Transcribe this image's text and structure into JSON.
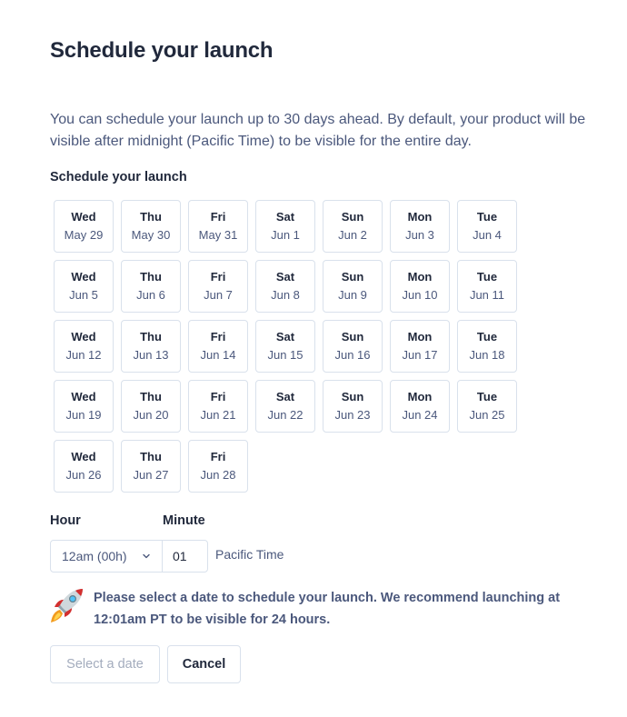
{
  "dialog": {
    "title": "Schedule your launch",
    "intro": "You can schedule your launch up to 30 days ahead. By default, your product will be visible after midnight (Pacific Time) to be visible for the entire day.",
    "section_label": "Schedule your launch"
  },
  "days": [
    {
      "dow": "Wed",
      "date": "May 29"
    },
    {
      "dow": "Thu",
      "date": "May 30"
    },
    {
      "dow": "Fri",
      "date": "May 31"
    },
    {
      "dow": "Sat",
      "date": "Jun 1"
    },
    {
      "dow": "Sun",
      "date": "Jun 2"
    },
    {
      "dow": "Mon",
      "date": "Jun 3"
    },
    {
      "dow": "Tue",
      "date": "Jun 4"
    },
    {
      "dow": "Wed",
      "date": "Jun 5"
    },
    {
      "dow": "Thu",
      "date": "Jun 6"
    },
    {
      "dow": "Fri",
      "date": "Jun 7"
    },
    {
      "dow": "Sat",
      "date": "Jun 8"
    },
    {
      "dow": "Sun",
      "date": "Jun 9"
    },
    {
      "dow": "Mon",
      "date": "Jun 10"
    },
    {
      "dow": "Tue",
      "date": "Jun 11"
    },
    {
      "dow": "Wed",
      "date": "Jun 12"
    },
    {
      "dow": "Thu",
      "date": "Jun 13"
    },
    {
      "dow": "Fri",
      "date": "Jun 14"
    },
    {
      "dow": "Sat",
      "date": "Jun 15"
    },
    {
      "dow": "Sun",
      "date": "Jun 16"
    },
    {
      "dow": "Mon",
      "date": "Jun 17"
    },
    {
      "dow": "Tue",
      "date": "Jun 18"
    },
    {
      "dow": "Wed",
      "date": "Jun 19"
    },
    {
      "dow": "Thu",
      "date": "Jun 20"
    },
    {
      "dow": "Fri",
      "date": "Jun 21"
    },
    {
      "dow": "Sat",
      "date": "Jun 22"
    },
    {
      "dow": "Sun",
      "date": "Jun 23"
    },
    {
      "dow": "Mon",
      "date": "Jun 24"
    },
    {
      "dow": "Tue",
      "date": "Jun 25"
    },
    {
      "dow": "Wed",
      "date": "Jun 26"
    },
    {
      "dow": "Thu",
      "date": "Jun 27"
    },
    {
      "dow": "Fri",
      "date": "Jun 28"
    }
  ],
  "time": {
    "hour_label": "Hour",
    "minute_label": "Minute",
    "hour_value": "12am (00h)",
    "minute_value": "01",
    "timezone": "Pacific Time"
  },
  "notice": {
    "icon": "rocket-icon",
    "text": "Please select a date to schedule your launch. We recommend launching at 12:01am PT to be visible for 24 hours."
  },
  "actions": {
    "select_label": "Select a date",
    "cancel_label": "Cancel"
  },
  "colors": {
    "text_dark": "#21293c",
    "text_muted": "#4b587c",
    "border": "#d9e1ec",
    "disabled_text": "#a3acbd"
  }
}
